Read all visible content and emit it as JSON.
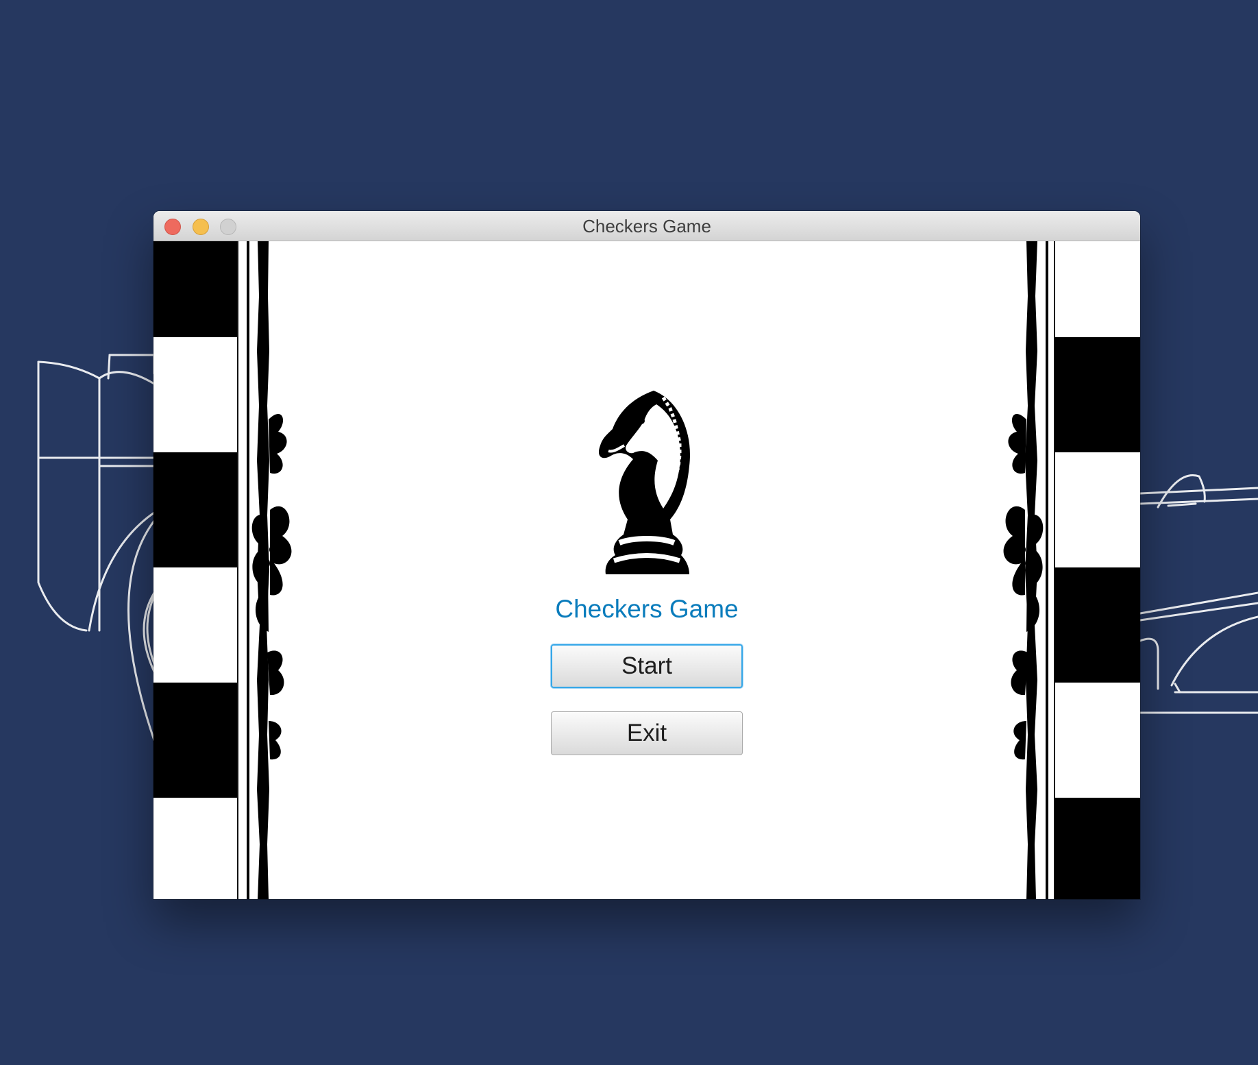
{
  "window": {
    "title": "Checkers Game"
  },
  "main": {
    "logo_icon": "knight-chess-piece-icon",
    "title": "Checkers Game",
    "start_label": "Start",
    "exit_label": "Exit"
  },
  "colors": {
    "desktop_background": "#263860",
    "title_accent": "#0a7cbc",
    "focus_ring": "#35a7e8",
    "close_button": "#ee6a5e",
    "minimize_button": "#f5bf4f",
    "zoom_button": "#d1d1d1"
  }
}
